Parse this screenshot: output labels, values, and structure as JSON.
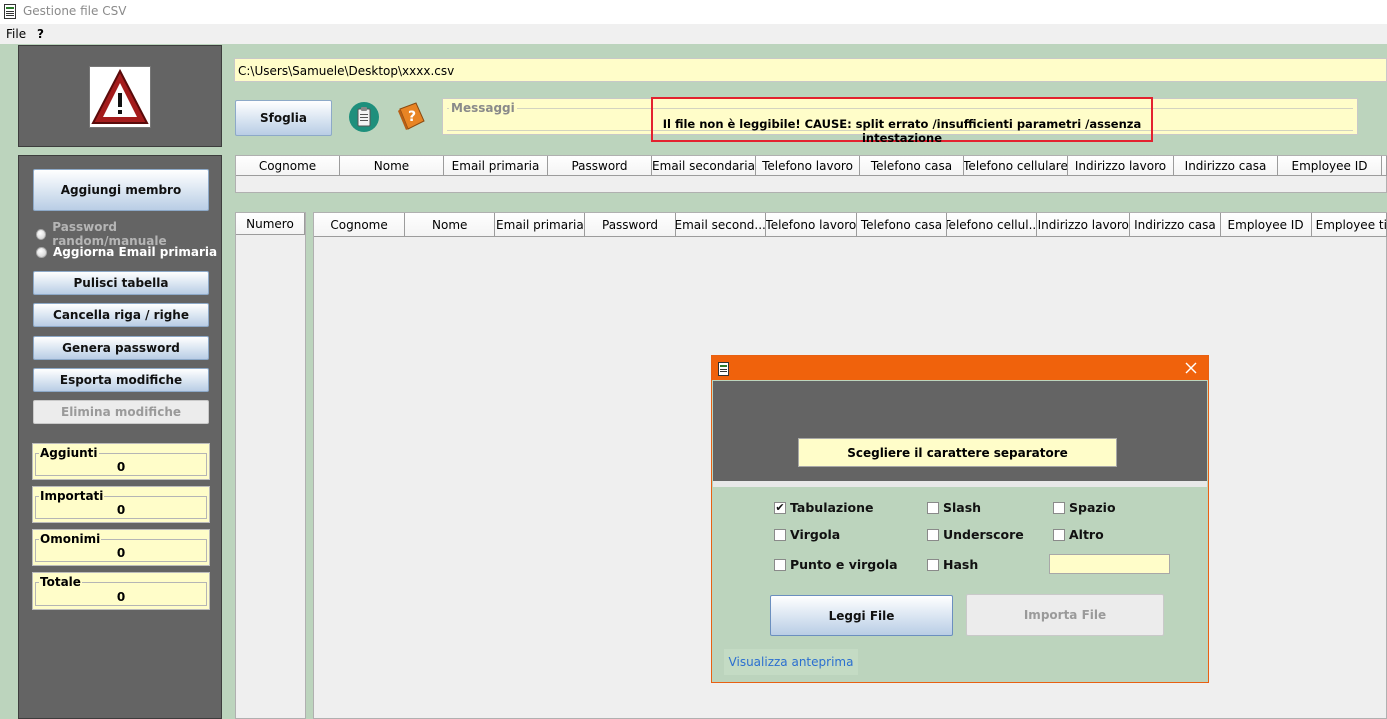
{
  "window": {
    "title": "Gestione file CSV",
    "icon": "csv-file-icon"
  },
  "menu": [
    "File",
    "?"
  ],
  "sidebar": {
    "warning_icon": "warning-triangle-icon",
    "buttons": [
      {
        "label": "Aggiungi membro"
      },
      {
        "label": "Pulisci tabella"
      },
      {
        "label": "Cancella riga / righe"
      },
      {
        "label": "Genera password"
      },
      {
        "label": "Esporta modifiche"
      },
      {
        "label": "Elimina modifiche",
        "disabled": true
      }
    ],
    "radios": [
      {
        "label": "Password random/manuale",
        "disabled": true
      },
      {
        "label": "Aggiorna Email primaria",
        "disabled": false
      }
    ],
    "counters": [
      {
        "label": "Aggiunti",
        "value": "0"
      },
      {
        "label": "Importati",
        "value": "0"
      },
      {
        "label": "Omonimi",
        "value": "0"
      },
      {
        "label": "Totale",
        "value": "0"
      }
    ]
  },
  "toolbar": {
    "path": "C:\\Users\\Samuele\\Desktop\\xxxx.csv",
    "browse_label": "Sfoglia",
    "icons": [
      "clipboard-icon",
      "help-book-icon"
    ]
  },
  "messages": {
    "legend": "Messaggi",
    "error": "Il file non è leggibile! CAUSE: split errato /insufficienti parametri /assenza intestazione",
    "highlight_color": "#e3222f"
  },
  "header_table": {
    "columns": [
      "Cognome",
      "Nome",
      "Email primaria",
      "Password",
      "Email secondaria",
      "Telefono lavoro",
      "Telefono casa",
      "Telefono cellulare",
      "Indirizzo lavoro",
      "Indirizzo casa",
      "Employee ID"
    ]
  },
  "main_table": {
    "number_column": "Numero",
    "columns": [
      "Cognome",
      "Nome",
      "Email primaria",
      "Password",
      "Email second...",
      "Telefono lavoro",
      "Telefono casa",
      "Telefono cellul...",
      "Indirizzo lavoro",
      "Indirizzo casa",
      "Employee ID",
      "Employee ti"
    ]
  },
  "dialog": {
    "title_icon": "csv-file-icon",
    "close_icon": "close-icon",
    "title_color": "#f0620c",
    "prompt": "Scegliere il carattere separatore",
    "separators": [
      {
        "label": "Tabulazione",
        "checked": true
      },
      {
        "label": "Slash",
        "checked": false
      },
      {
        "label": "Spazio",
        "checked": false
      },
      {
        "label": "Virgola",
        "checked": false
      },
      {
        "label": "Underscore",
        "checked": false
      },
      {
        "label": "Altro",
        "checked": false
      },
      {
        "label": "Punto e virgola",
        "checked": false
      },
      {
        "label": "Hash",
        "checked": false
      }
    ],
    "other_value": "",
    "read_button": "Leggi File",
    "import_button": "Importa File",
    "preview_link": "Visualizza anteprima"
  }
}
